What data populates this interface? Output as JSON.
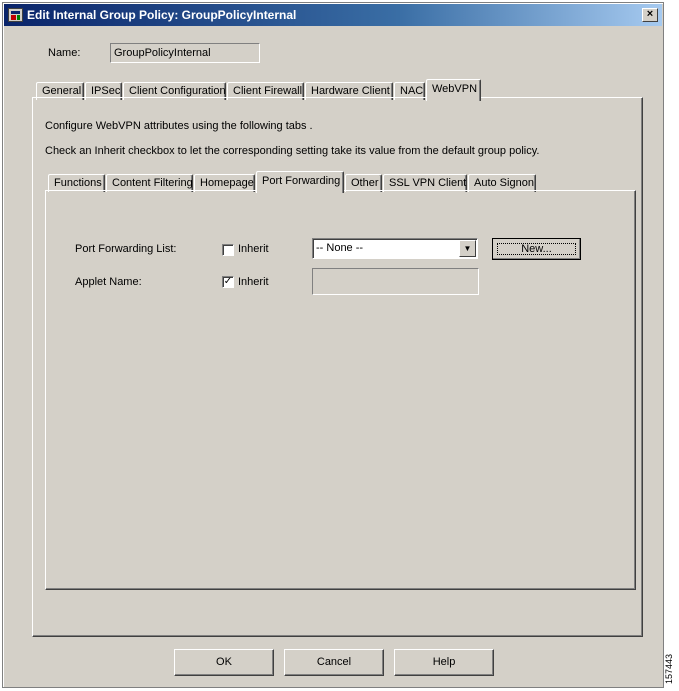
{
  "window": {
    "title": "Edit Internal Group Policy: GroupPolicyInternal",
    "close_glyph": "×"
  },
  "name": {
    "label": "Name:",
    "value": "GroupPolicyInternal"
  },
  "main_tabs": [
    {
      "label": "General"
    },
    {
      "label": "IPSec"
    },
    {
      "label": "Client Configuration"
    },
    {
      "label": "Client Firewall"
    },
    {
      "label": "Hardware Client"
    },
    {
      "label": "NAC"
    },
    {
      "label": "WebVPN",
      "active": true
    }
  ],
  "description": {
    "line1": "Configure WebVPN attributes using the following tabs .",
    "line2": "Check an Inherit checkbox to let the corresponding setting take its value from the default group policy."
  },
  "sub_tabs": [
    {
      "label": "Functions"
    },
    {
      "label": "Content Filtering"
    },
    {
      "label": "Homepage"
    },
    {
      "label": "Port Forwarding",
      "active": true
    },
    {
      "label": "Other"
    },
    {
      "label": "SSL VPN Client"
    },
    {
      "label": "Auto Signon"
    }
  ],
  "port_forwarding": {
    "list_label": "Port Forwarding List:",
    "list_inherit_label": "Inherit",
    "list_inherit_checked": false,
    "list_value": "-- None --",
    "new_button": "New...",
    "applet_label": "Applet Name:",
    "applet_inherit_label": "Inherit",
    "applet_inherit_checked": true,
    "applet_value": ""
  },
  "buttons": {
    "ok": "OK",
    "cancel": "Cancel",
    "help": "Help"
  },
  "figure_id": "157443",
  "colors": {
    "face": "#d4d0c8",
    "title_start": "#0a246a",
    "title_end": "#a6caf0"
  }
}
